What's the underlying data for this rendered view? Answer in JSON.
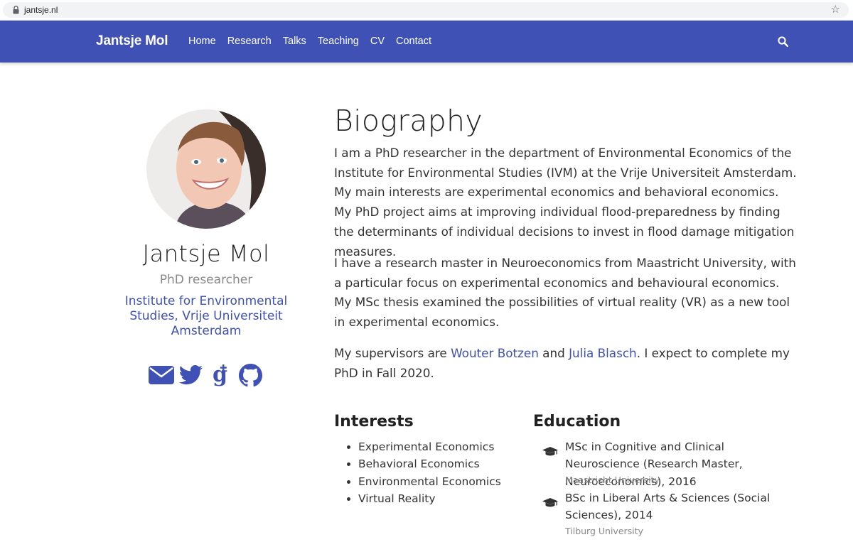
{
  "browser": {
    "url": "jantsje.nl",
    "lock_icon": "lock-icon",
    "bookmark_icon": "star-icon"
  },
  "navbar": {
    "brand": "Jantsje Mol",
    "links": [
      "Home",
      "Research",
      "Talks",
      "Teaching",
      "CV",
      "Contact"
    ],
    "search_icon": "search-icon",
    "color": "#3f51b5"
  },
  "profile": {
    "name": "Jantsje Mol",
    "role": "PhD researcher",
    "organization": "Institute for Environmental Studies, Vrije Universiteit Amsterdam",
    "social_icons": [
      "envelope-icon",
      "twitter-icon",
      "google-scholar-icon",
      "github-icon"
    ]
  },
  "biography": {
    "title": "Biography",
    "paragraph1": "I am a PhD researcher in the department of Environmental Economics of the Institute for Environmental Studies (IVM) at the Vrije Universiteit Amsterdam. My main interests are experimental economics and behavioral economics. My PhD project aims at improving individual flood-preparedness by finding the determinants of individual decisions to invest in flood damage mitigation measures.",
    "paragraph2": "I have a research master in Neuroeconomics from Maastricht University, with a particular focus on experimental economics and behavioural economics. My MSc thesis examined the possibilities of virtual reality (VR) as a new tool in experimental economics.",
    "p3_before": "My supervisors are ",
    "supervisor1": "Wouter Botzen",
    "p3_and": " and ",
    "supervisor2": "Julia Blasch",
    "p3_after": ". I expect to complete my PhD in Fall 2020."
  },
  "interests": {
    "title": "Interests",
    "items": [
      "Experimental Economics",
      "Behavioral Economics",
      "Environmental Economics",
      "Virtual Reality"
    ]
  },
  "education": {
    "title": "Education",
    "items": [
      {
        "course": "MSc in Cognitive and Clinical Neuroscience (Research Master, Neuroeconomics), 2016",
        "institution": "Maastricht University",
        "icon": "graduation-cap-icon"
      },
      {
        "course": "BSc in Liberal Arts & Sciences (Social Sciences), 2014",
        "institution": "Tilburg University",
        "icon": "graduation-cap-icon"
      }
    ]
  }
}
